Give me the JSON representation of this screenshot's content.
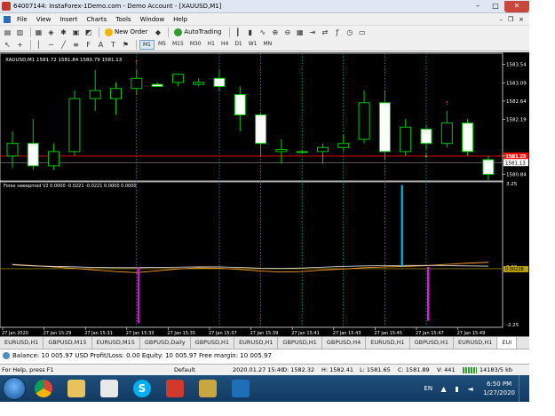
{
  "window": {
    "title": "64007144: InstaForex-1Demo.com - Demo Account - [XAUUSD,M1]",
    "min_glyph": "–",
    "max_glyph": "□",
    "close_glyph": "✕"
  },
  "menu": {
    "items": [
      "File",
      "View",
      "Insert",
      "Charts",
      "Tools",
      "Window",
      "Help"
    ],
    "min": "–",
    "restore": "❒",
    "close": "×"
  },
  "toolbar": {
    "new_order_label": "New Order",
    "autotrading_label": "AutoTrading",
    "timeframes": [
      "M1",
      "M5",
      "M15",
      "M30",
      "H1",
      "H4",
      "D1",
      "W1",
      "MN"
    ],
    "active_timeframe": "M1"
  },
  "chart": {
    "header": "XAUUSD,M1  1581.72 1581.84 1580.79 1581.13",
    "indicator_header": "Forex sweepmod V2 0.0000 -0.0221 -0.0221 0.0000 0.0000",
    "bid_price_label": "1581.13",
    "red_line_label": "1581.72",
    "price_ticks": [
      "1583.54",
      "1583.09",
      "1582.64",
      "1582.19",
      "1581.29",
      "1580.84"
    ],
    "indicator_ticks": [
      "3.25",
      "0.00",
      "-2.25"
    ],
    "indicator_value_label": "0.00228",
    "time_labels": [
      "27 Jan 2020",
      "27 Jan 15:29",
      "27 Jan 15:31",
      "27 Jan 15:33",
      "27 Jan 15:35",
      "27 Jan 15:37",
      "27 Jan 15:39",
      "27 Jan 15:41",
      "27 Jan 15:43",
      "27 Jan 15:45",
      "27 Jan 15:47",
      "27 Jan 15:49"
    ],
    "colors": {
      "bull": "#00c800",
      "bear_body": "#ffffff",
      "bid_line": "#ff0000",
      "grid": "#00c8c8",
      "osc_orange": "#ff9a2a",
      "osc_white": "#e8e8e8",
      "spike_cyan": "#00c8ff",
      "spike_magenta": "#ff00ff",
      "zero_line": "#8a7a00"
    }
  },
  "chart_data": {
    "type": "candlestick",
    "x": [
      "15:27",
      "15:28",
      "15:29",
      "15:30",
      "15:31",
      "15:32",
      "15:33",
      "15:34",
      "15:35",
      "15:36",
      "15:37",
      "15:38",
      "15:39",
      "15:40",
      "15:41",
      "15:42",
      "15:43",
      "15:44",
      "15:45",
      "15:46",
      "15:47",
      "15:48",
      "15:49",
      "15:50"
    ],
    "ohlc": [
      [
        1581.29,
        1581.9,
        1581.0,
        1581.6
      ],
      [
        1581.6,
        1582.2,
        1580.95,
        1581.05
      ],
      [
        1581.05,
        1581.6,
        1580.95,
        1581.4
      ],
      [
        1581.4,
        1582.9,
        1581.3,
        1582.7
      ],
      [
        1582.7,
        1583.4,
        1582.4,
        1582.9
      ],
      [
        1582.7,
        1583.1,
        1582.3,
        1582.95
      ],
      [
        1582.95,
        1583.4,
        1582.8,
        1583.2
      ],
      [
        1583.05,
        1583.1,
        1583.0,
        1583.0
      ],
      [
        1583.1,
        1583.3,
        1583.0,
        1583.3
      ],
      [
        1583.05,
        1583.2,
        1583.0,
        1583.1
      ],
      [
        1583.2,
        1583.4,
        1582.9,
        1583.0
      ],
      [
        1582.8,
        1583.0,
        1581.9,
        1582.3
      ],
      [
        1582.3,
        1582.35,
        1581.3,
        1581.6
      ],
      [
        1581.4,
        1581.7,
        1581.1,
        1581.45
      ],
      [
        1581.4,
        1581.45,
        1581.35,
        1581.4
      ],
      [
        1581.4,
        1581.6,
        1581.1,
        1581.5
      ],
      [
        1581.5,
        1581.8,
        1581.4,
        1581.6
      ],
      [
        1581.7,
        1582.9,
        1581.6,
        1582.6
      ],
      [
        1582.6,
        1582.9,
        1581.2,
        1581.4
      ],
      [
        1581.4,
        1582.2,
        1581.3,
        1582.0
      ],
      [
        1581.95,
        1582.05,
        1581.45,
        1581.6
      ],
      [
        1581.6,
        1582.4,
        1581.5,
        1582.1
      ],
      [
        1582.1,
        1582.2,
        1581.3,
        1581.4
      ],
      [
        1581.2,
        1581.3,
        1580.7,
        1580.84
      ]
    ],
    "ylim": [
      1580.7,
      1583.75
    ],
    "bid_line": 1581.29,
    "indicator": {
      "ylim": [
        -2.25,
        3.25
      ],
      "spikes": [
        {
          "x": "15:33",
          "value": -2.2,
          "color": "magenta"
        },
        {
          "x": "15:46",
          "value": 3.2,
          "color": "cyan"
        },
        {
          "x": "15:47",
          "value": -2.1,
          "color": "magenta"
        }
      ],
      "orange_line": [
        0.1,
        0.05,
        0.0,
        -0.06,
        -0.12,
        -0.18,
        -0.22,
        -0.15,
        -0.08,
        -0.04,
        -0.05,
        -0.1,
        -0.16,
        -0.2,
        -0.18,
        -0.12,
        -0.08,
        -0.03,
        0.0,
        0.02,
        0.05,
        0.1,
        0.15,
        0.18
      ],
      "white_line": [
        0.08,
        0.04,
        0.02,
        0.0,
        -0.02,
        -0.03,
        -0.03,
        -0.02,
        -0.01,
        0.0,
        0.0,
        -0.02,
        -0.05,
        -0.06,
        -0.04,
        -0.01,
        0.02,
        0.04,
        0.05,
        0.06,
        0.06,
        0.05,
        0.04,
        0.03
      ]
    },
    "vlines": [
      "15:33",
      "15:37",
      "15:39",
      "15:41",
      "15:43",
      "15:45",
      "15:47"
    ],
    "fractals_up": [
      "15:33",
      "15:48"
    ],
    "fractals_down": [
      "15:47"
    ]
  },
  "tabs": [
    "EURUSD,H1",
    "GBPUSD,M15",
    "EURUSD,M15",
    "GBPUSD,Daily",
    "GBPUSD,H1",
    "EURUSD,H1",
    "GBPUSD,H1",
    "GBPUSD,H4",
    "EURUSD,H1",
    "GBPUSD,H1",
    "EURUSD,H1",
    "EUI"
  ],
  "active_tab": 11,
  "balance": {
    "text": "Balance: 10 005.97 USD  Profit/Loss: 0.00  Equity: 10 005.97  Free margin: 10 005.97"
  },
  "status": {
    "help": "For Help, press F1",
    "profile": "Default",
    "datetime": "2020.01.27 15:40",
    "open": "O: 1582.32",
    "high": "H: 1582.41",
    "low": "L: 1581.65",
    "close": "C: 1581.89",
    "volume": "V: 441",
    "traffic": "14183/5 kb"
  },
  "taskbar": {
    "language": "EN",
    "time": "6:50 PM",
    "date": "1/27/2020",
    "skype_glyph": "S"
  }
}
